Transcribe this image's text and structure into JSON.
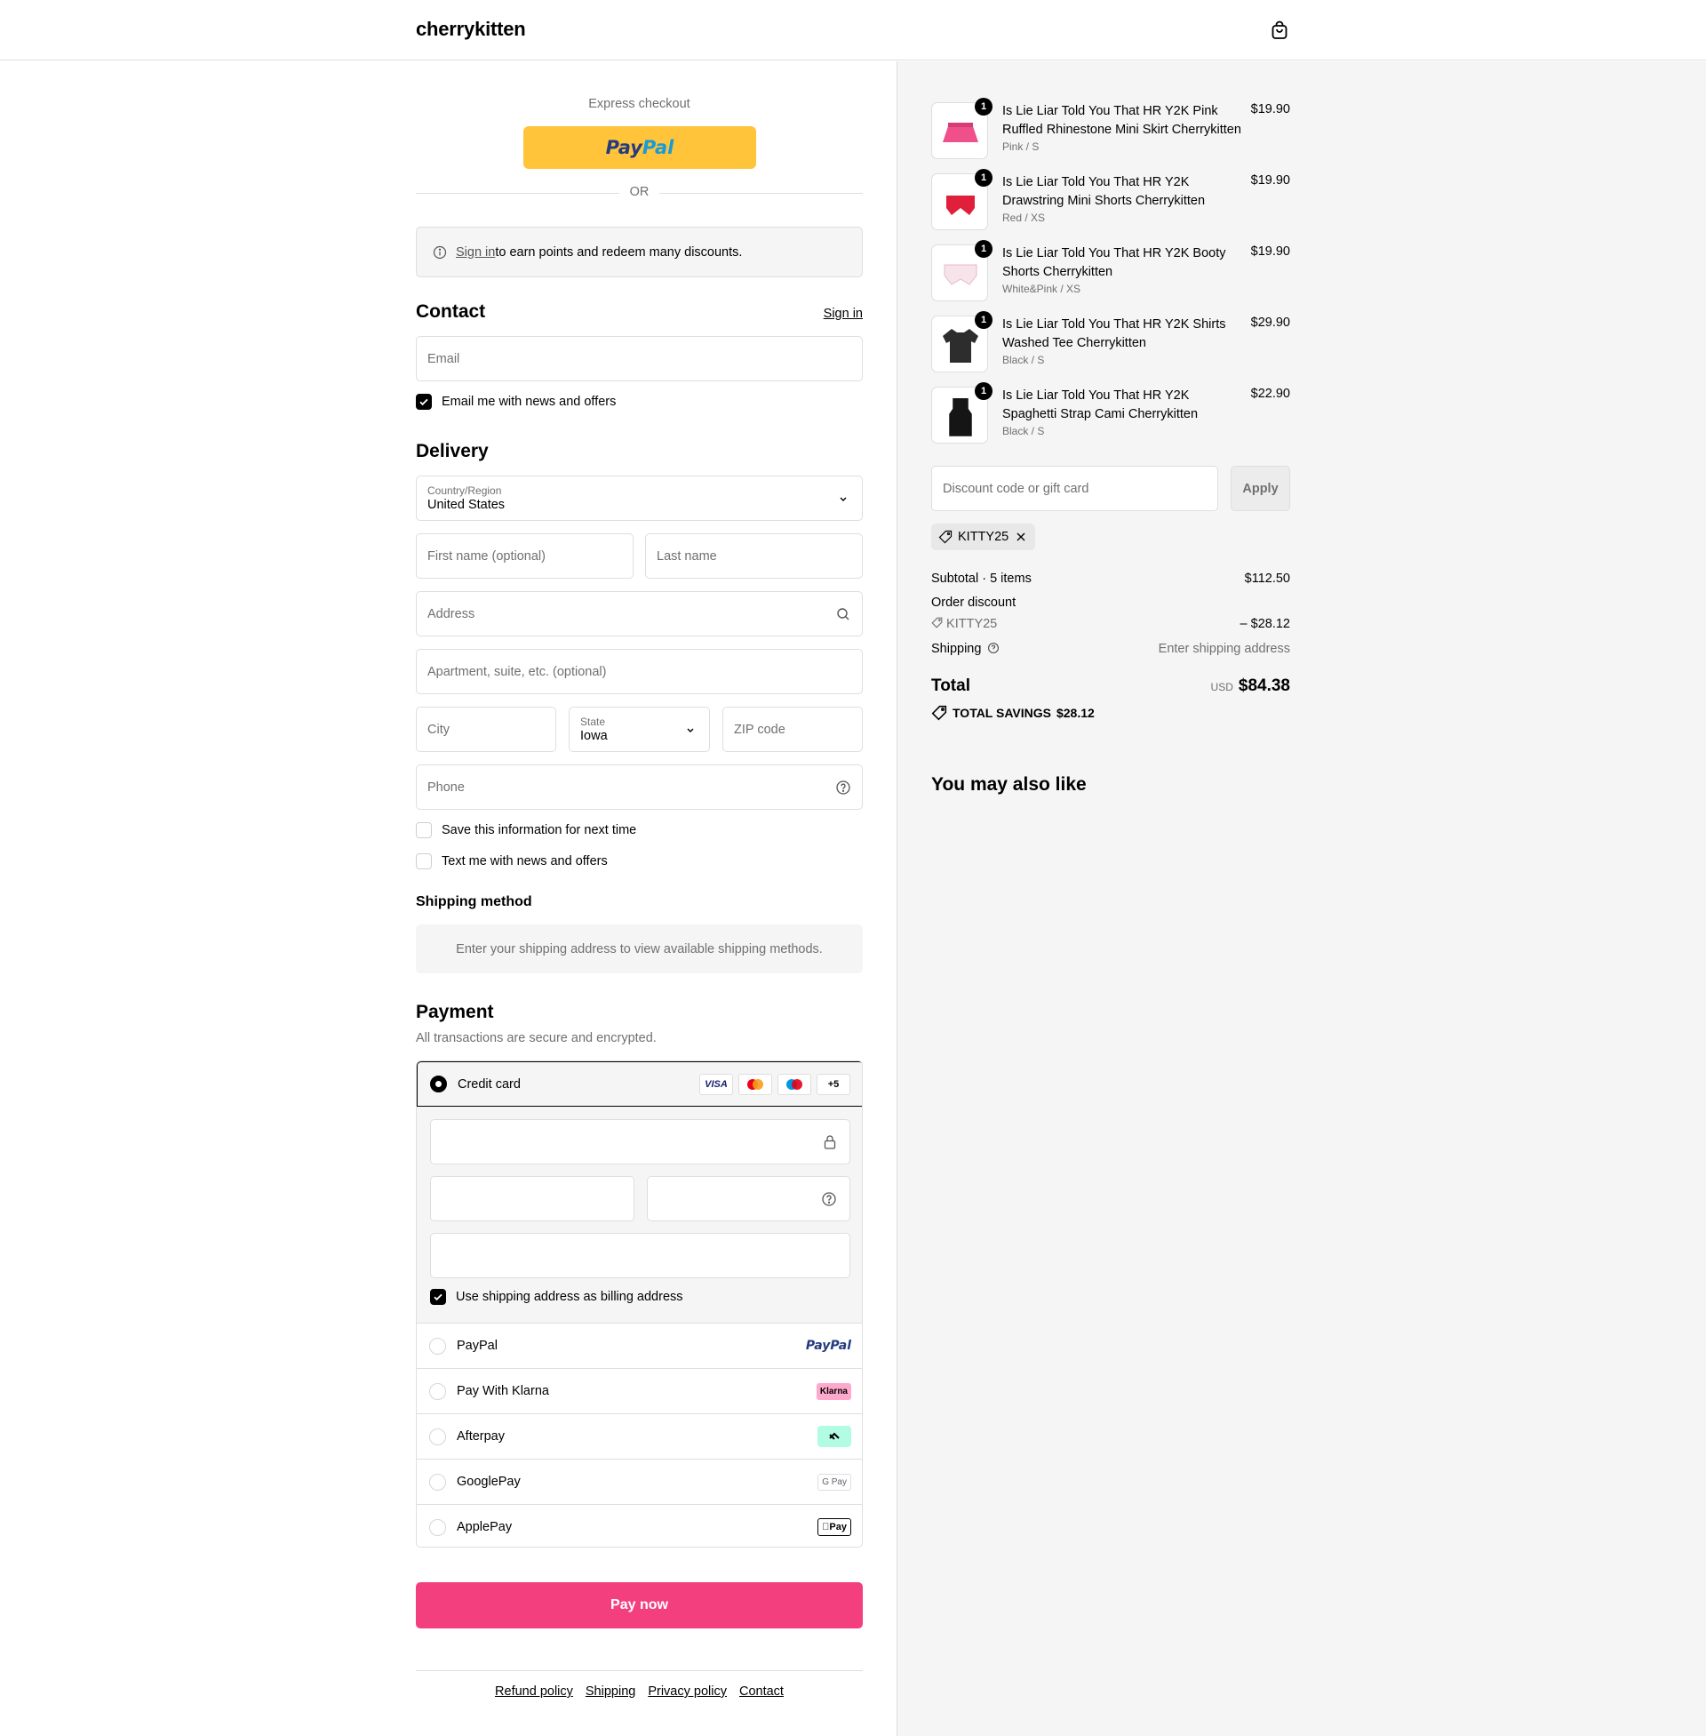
{
  "header": {
    "brand": "cherrykitten"
  },
  "express": {
    "label": "Express checkout",
    "paypal_part1": "Pay",
    "paypal_part2": "Pal",
    "or": "OR"
  },
  "signin_banner": {
    "link": "Sign in",
    "text": " to earn points and redeem many discounts."
  },
  "contact": {
    "title": "Contact",
    "signin": "Sign in",
    "email_placeholder": "Email",
    "news_checkbox": "Email me with news and offers",
    "news_checked": true
  },
  "delivery": {
    "title": "Delivery",
    "country_label": "Country/Region",
    "country_value": "United States",
    "first_name": "First name (optional)",
    "last_name": "Last name",
    "address": "Address",
    "apartment": "Apartment, suite, etc. (optional)",
    "city": "City",
    "state_label": "State",
    "state_value": "Iowa",
    "zip": "ZIP code",
    "phone": "Phone",
    "save_info": "Save this information for next time",
    "text_me": "Text me with news and offers"
  },
  "shipping_method": {
    "title": "Shipping method",
    "message": "Enter your shipping address to view available shipping methods."
  },
  "payment": {
    "title": "Payment",
    "subtitle": "All transactions are secure and encrypted.",
    "credit_card": "Credit card",
    "card_badges": [
      "VISA",
      "",
      "",
      "+5"
    ],
    "billing_same": "Use shipping address as billing address",
    "methods": [
      {
        "label": "PayPal",
        "logo": "PayPal"
      },
      {
        "label": "Pay With Klarna",
        "logo": "Klarna"
      },
      {
        "label": "Afterpay",
        "logo": "afterpay-icon"
      },
      {
        "label": "GooglePay",
        "logo": "G Pay"
      },
      {
        "label": "ApplePay",
        "logo": "Pay"
      }
    ],
    "pay_now": "Pay now"
  },
  "footer": {
    "links": [
      "Refund policy",
      "Shipping",
      "Privacy policy",
      "Contact"
    ]
  },
  "summary": {
    "items": [
      {
        "name": "Is Lie Liar Told You That HR Y2K Pink Ruffled Rhinestone Mini Skirt Cherrykitten",
        "variant": "Pink / S",
        "price": "$19.90",
        "qty": "1",
        "color": "#f0508a"
      },
      {
        "name": "Is Lie Liar Told You That HR Y2K Drawstring Mini Shorts Cherrykitten",
        "variant": "Red / XS",
        "price": "$19.90",
        "qty": "1",
        "color": "#e01f3a"
      },
      {
        "name": "Is Lie Liar Told You That HR Y2K Booty Shorts Cherrykitten",
        "variant": "White&Pink / XS",
        "price": "$19.90",
        "qty": "1",
        "color": "#f3dbe4"
      },
      {
        "name": "Is Lie Liar Told You That HR Y2K Shirts Washed Tee Cherrykitten",
        "variant": "Black / S",
        "price": "$29.90",
        "qty": "1",
        "color": "#2d2d2d"
      },
      {
        "name": "Is Lie Liar Told You That HR Y2K Spaghetti Strap Cami Cherrykitten",
        "variant": "Black / S",
        "price": "$22.90",
        "qty": "1",
        "color": "#151515"
      }
    ],
    "discount_placeholder": "Discount code or gift card",
    "apply": "Apply",
    "applied_code": "KITTY25",
    "subtotal_label": "Subtotal · 5 items",
    "subtotal_value": "$112.50",
    "order_discount_label": "Order discount",
    "discount_code": "KITTY25",
    "discount_value": "– $28.12",
    "shipping_label": "Shipping",
    "shipping_value": "Enter shipping address",
    "total_label": "Total",
    "total_currency": "USD",
    "total_value": "$84.38",
    "savings_label": "TOTAL SAVINGS",
    "savings_value": "$28.12",
    "also_like": "You may also like"
  },
  "colors": {
    "accent": "#f43f7e",
    "paypal_yellow": "#ffc439",
    "panel_bg": "#f5f5f5"
  }
}
